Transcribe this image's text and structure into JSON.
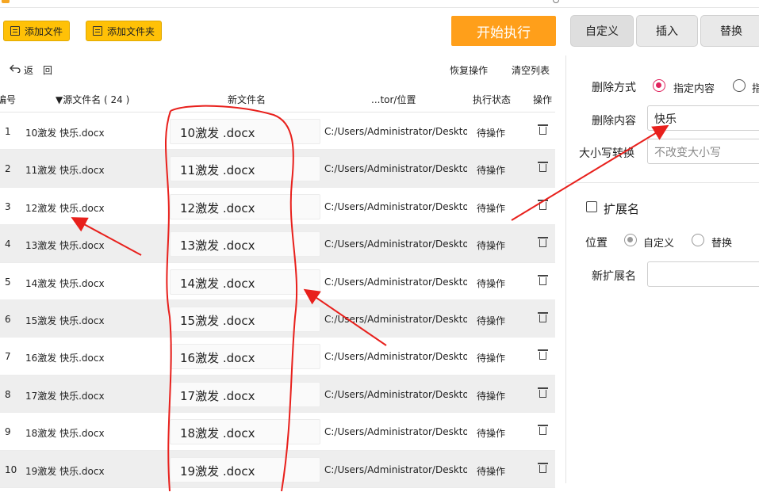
{
  "toolbar": {
    "add_file": "添加文件",
    "add_folder": "添加文件夹",
    "start": "开始执行",
    "tabs": [
      "自定义",
      "插入",
      "替换"
    ]
  },
  "subtoolbar": {
    "back_label": "返",
    "back_label2": "回",
    "restore": "恢复操作",
    "clear": "清空列表"
  },
  "table": {
    "headers": {
      "num": "编号",
      "source": "▼源文件名 ( 24 )",
      "newname": "新文件名",
      "location": "...tor/位置",
      "status": "执行状态",
      "action": "操作"
    },
    "rows": [
      {
        "num": "1",
        "source": "10激发 快乐.docx",
        "newname": "10激发 .docx",
        "path": "C:/Users/Administrator/Desktop,",
        "status": "待操作"
      },
      {
        "num": "2",
        "source": "11激发 快乐.docx",
        "newname": "11激发 .docx",
        "path": "C:/Users/Administrator/Desktop,",
        "status": "待操作"
      },
      {
        "num": "3",
        "source": "12激发 快乐.docx",
        "newname": "12激发 .docx",
        "path": "C:/Users/Administrator/Desktop,",
        "status": "待操作"
      },
      {
        "num": "4",
        "source": "13激发 快乐.docx",
        "newname": "13激发 .docx",
        "path": "C:/Users/Administrator/Desktop,",
        "status": "待操作"
      },
      {
        "num": "5",
        "source": "14激发 快乐.docx",
        "newname": "14激发 .docx",
        "path": "C:/Users/Administrator/Desktop,",
        "status": "待操作"
      },
      {
        "num": "6",
        "source": "15激发 快乐.docx",
        "newname": "15激发 .docx",
        "path": "C:/Users/Administrator/Desktop,",
        "status": "待操作"
      },
      {
        "num": "7",
        "source": "16激发 快乐.docx",
        "newname": "16激发 .docx",
        "path": "C:/Users/Administrator/Desktop,",
        "status": "待操作"
      },
      {
        "num": "8",
        "source": "17激发 快乐.docx",
        "newname": "17激发 .docx",
        "path": "C:/Users/Administrator/Desktop,",
        "status": "待操作"
      },
      {
        "num": "9",
        "source": "18激发 快乐.docx",
        "newname": "18激发 .docx",
        "path": "C:/Users/Administrator/Desktop,",
        "status": "待操作"
      },
      {
        "num": "10",
        "source": "19激发 快乐.docx",
        "newname": "19激发 .docx",
        "path": "C:/Users/Administrator/Desktop,",
        "status": "待操作"
      }
    ]
  },
  "right_panel": {
    "delete_mode_label": "删除方式",
    "delete_mode_option1": "指定内容",
    "delete_mode_option2": "指",
    "delete_content_label": "删除内容",
    "delete_content_value": "快乐",
    "case_label": "大小写转换",
    "case_placeholder": "不改变大小写",
    "ext_label": "扩展名",
    "position_label": "位置",
    "position_option1": "自定义",
    "position_option2": "替换",
    "new_ext_label": "新扩展名"
  },
  "colors": {
    "accent_yellow": "#ffc107",
    "start_orange": "#ff9f1a",
    "radio_selected": "#e0245e",
    "annotation_red": "#e8201c"
  }
}
